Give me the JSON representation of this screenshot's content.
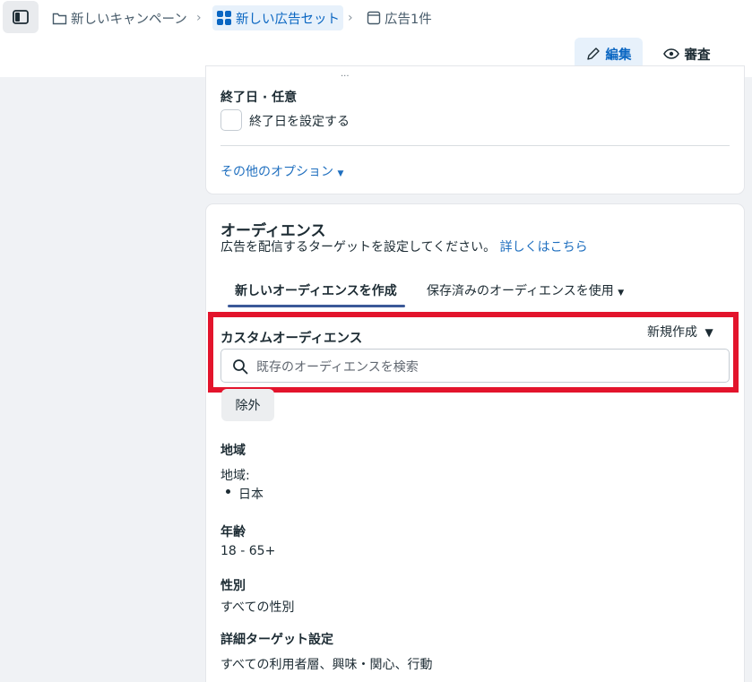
{
  "breadcrumb": {
    "items": [
      {
        "label": "新しいキャンペーン",
        "icon": "folder-icon"
      },
      {
        "label": "新しい広告セット",
        "icon": "grid-icon"
      },
      {
        "label": "広告1件",
        "icon": "ad-icon"
      }
    ]
  },
  "header": {
    "edit_label": "編集",
    "review_label": "審査"
  },
  "schedule": {
    "partial_text": "...",
    "end_date_label": "終了日 · 任意",
    "end_date_checkbox_label": "終了日を設定する",
    "more_options_label": "その他のオプション"
  },
  "audience": {
    "title": "オーディエンス",
    "description": "広告を配信するターゲットを設定してください。",
    "learn_more": "詳しくはこちら",
    "tabs": [
      {
        "label": "新しいオーディエンスを作成",
        "active": true
      },
      {
        "label": "保存済みのオーディエンスを使用",
        "active": false
      }
    ],
    "custom_audience_label": "カスタムオーディエンス",
    "create_new_label": "新規作成",
    "search_placeholder": "既存のオーディエンスを検索",
    "exclude_label": "除外",
    "location_heading": "地域",
    "location_sub": "地域:",
    "location_value": "日本",
    "age_heading": "年齢",
    "age_value": "18 - 65+",
    "gender_heading": "性別",
    "gender_value": "すべての性別",
    "detailed_heading": "詳細ターゲット設定",
    "detailed_value": "すべての利用者層、興味・関心、行動"
  },
  "colors": {
    "accent": "#0a66c2",
    "highlight_border": "#e3142c",
    "tab_underline": "#3b5998"
  }
}
